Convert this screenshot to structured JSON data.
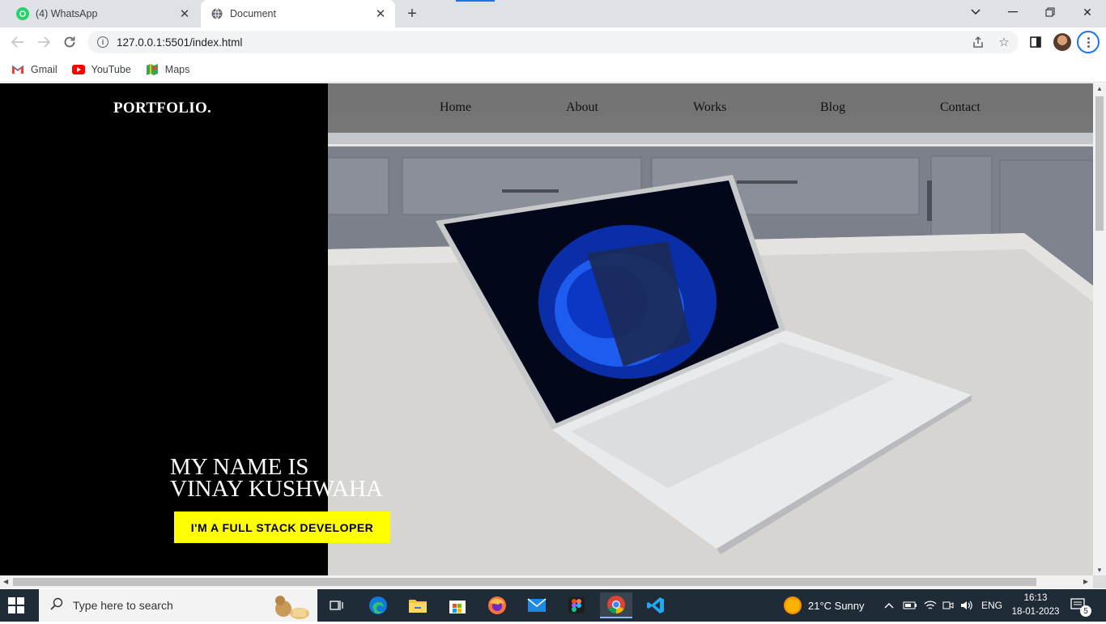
{
  "browser": {
    "tabs": [
      {
        "label": "(4) WhatsApp",
        "active": false
      },
      {
        "label": "Document",
        "active": true
      }
    ],
    "url": "127.0.0.1:5501/index.html",
    "bookmarks": [
      {
        "label": "Gmail",
        "icon": "gmail-icon"
      },
      {
        "label": "YouTube",
        "icon": "youtube-icon"
      },
      {
        "label": "Maps",
        "icon": "maps-icon"
      }
    ]
  },
  "page": {
    "logo": "PORTFOLIO.",
    "nav": [
      "Home",
      "About",
      "Works",
      "Blog",
      "Contact"
    ],
    "heading_line1": "MY NAME IS",
    "heading_line2": "VINAY KUSHWAHA",
    "cta": "I'M A FULL STACK DEVELOPER",
    "colors": {
      "left_panel": "#000000",
      "cta_bg": "#ffff00",
      "navbar": "#707070"
    }
  },
  "taskbar": {
    "search_placeholder": "Type here to search",
    "weather": "21°C  Sunny",
    "language": "ENG",
    "time": "16:13",
    "date": "18-01-2023",
    "notifications": "5"
  }
}
